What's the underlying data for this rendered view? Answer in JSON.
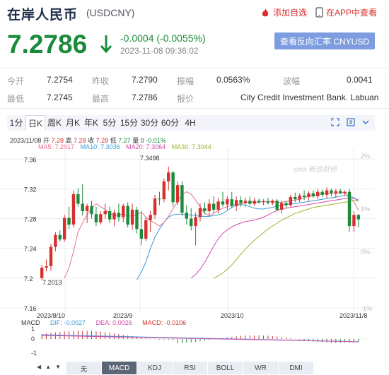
{
  "header": {
    "title": "在岸人民币",
    "code": "(USDCNY)",
    "watch_label": "添加自选",
    "app_label": "在APP中查看"
  },
  "quote": {
    "price": "7.2786",
    "change": "-0.0004 (-0.0055%)",
    "time": "2023-11-08 09:36:02",
    "reverse_label": "查看反向汇率 CNYUSD"
  },
  "stats": {
    "open_label": "今开",
    "open": "7.2754",
    "prev_label": "昨收",
    "prev": "7.2790",
    "amp_label": "振幅",
    "amp": "0.0563%",
    "wave_label": "波幅",
    "wave": "0.0041",
    "low_label": "最低",
    "low": "7.2745",
    "high_label": "最高",
    "high": "7.2786",
    "quote_label": "报价",
    "quote_src": "City Credit Investment Bank. Labuan"
  },
  "tabs": [
    "1分",
    "日K",
    "周K",
    "月K",
    "年K",
    "5分",
    "15分",
    "30分",
    "60分",
    "4H"
  ],
  "active_tab": 1,
  "ohlc_line": {
    "date": "2023/11/08",
    "open_label": "开",
    "open": "7.28",
    "high_label": "高",
    "high": "7.28",
    "close_label": "收",
    "close": "7.28",
    "low_label": "低",
    "low": "7.27",
    "vol_label": "量",
    "vol": "0",
    "pct": "-0.01%"
  },
  "ma": {
    "ma5": "MA5: 7.2917",
    "ma10": "MA10: 7.3036",
    "ma20": "MA20: 7.3064",
    "ma30": "MA30: 7.3044"
  },
  "colors": {
    "up": "#d8302f",
    "down": "#1a8a3b",
    "ma5": "#e8728c",
    "ma10": "#3b9ad9",
    "ma20": "#d24aa8",
    "ma30": "#9bb52f"
  },
  "chart_data": {
    "type": "candlestick",
    "y_ticks": [
      "7.36",
      "7.32",
      "7.28",
      "7.24",
      "7.2",
      "7.16"
    ],
    "y_ticks_pct": [
      "2%",
      "1%",
      "0%",
      "-1%"
    ],
    "x_ticks": [
      "2023/8/10",
      "2023/9",
      "2023/10",
      "2023/11/8"
    ],
    "max_label": "7.3498",
    "min_label": "7.2013",
    "ylim": [
      7.16,
      7.365
    ],
    "candles": [
      [
        7.2,
        7.218,
        7.197,
        7.214
      ],
      [
        7.214,
        7.225,
        7.209,
        7.216
      ],
      [
        7.216,
        7.246,
        7.21,
        7.242
      ],
      [
        7.242,
        7.262,
        7.236,
        7.258
      ],
      [
        7.258,
        7.264,
        7.249,
        7.252
      ],
      [
        7.252,
        7.285,
        7.249,
        7.281
      ],
      [
        7.281,
        7.296,
        7.266,
        7.272
      ],
      [
        7.272,
        7.318,
        7.268,
        7.313
      ],
      [
        7.313,
        7.321,
        7.296,
        7.3
      ],
      [
        7.3,
        7.326,
        7.284,
        7.29
      ],
      [
        7.29,
        7.3,
        7.274,
        7.297
      ],
      [
        7.297,
        7.304,
        7.28,
        7.286
      ],
      [
        7.286,
        7.296,
        7.27,
        7.275
      ],
      [
        7.275,
        7.29,
        7.272,
        7.286
      ],
      [
        7.286,
        7.3,
        7.28,
        7.29
      ],
      [
        7.29,
        7.296,
        7.274,
        7.279
      ],
      [
        7.279,
        7.292,
        7.27,
        7.288
      ],
      [
        7.288,
        7.3,
        7.276,
        7.282
      ],
      [
        7.282,
        7.3,
        7.275,
        7.297
      ],
      [
        7.297,
        7.302,
        7.268,
        7.272
      ],
      [
        7.272,
        7.3,
        7.265,
        7.292
      ],
      [
        7.292,
        7.296,
        7.26,
        7.266
      ],
      [
        7.266,
        7.29,
        7.244,
        7.253
      ],
      [
        7.253,
        7.282,
        7.25,
        7.278
      ],
      [
        7.278,
        7.29,
        7.262,
        7.285
      ],
      [
        7.285,
        7.312,
        7.28,
        7.307
      ],
      [
        7.307,
        7.316,
        7.298,
        7.306
      ],
      [
        7.306,
        7.334,
        7.302,
        7.33
      ],
      [
        7.33,
        7.35,
        7.318,
        7.342
      ],
      [
        7.342,
        7.344,
        7.296,
        7.302
      ],
      [
        7.302,
        7.33,
        7.298,
        7.325
      ],
      [
        7.325,
        7.33,
        7.284,
        7.288
      ],
      [
        7.288,
        7.298,
        7.272,
        7.28
      ],
      [
        7.28,
        7.294,
        7.264,
        7.27
      ],
      [
        7.27,
        7.288,
        7.244,
        7.282
      ],
      [
        7.282,
        7.3,
        7.276,
        7.294
      ],
      [
        7.294,
        7.302,
        7.286,
        7.29
      ],
      [
        7.29,
        7.306,
        7.284,
        7.3
      ],
      [
        7.3,
        7.31,
        7.288,
        7.292
      ],
      [
        7.292,
        7.308,
        7.287,
        7.303
      ],
      [
        7.303,
        7.316,
        7.296,
        7.299
      ],
      [
        7.299,
        7.31,
        7.292,
        7.306
      ],
      [
        7.306,
        7.316,
        7.294,
        7.297
      ],
      [
        7.297,
        7.31,
        7.29,
        7.305
      ],
      [
        7.305,
        7.31,
        7.296,
        7.301
      ],
      [
        7.301,
        7.308,
        7.296,
        7.304
      ],
      [
        7.304,
        7.31,
        7.298,
        7.3
      ],
      [
        7.3,
        7.308,
        7.297,
        7.304
      ],
      [
        7.304,
        7.307,
        7.3,
        7.302
      ],
      [
        7.302,
        7.306,
        7.298,
        7.303
      ],
      [
        7.303,
        7.308,
        7.299,
        7.301
      ],
      [
        7.301,
        7.306,
        7.298,
        7.304
      ],
      [
        7.304,
        7.306,
        7.29,
        7.292
      ],
      [
        7.292,
        7.304,
        7.287,
        7.301
      ],
      [
        7.301,
        7.304,
        7.294,
        7.298
      ],
      [
        7.298,
        7.312,
        7.296,
        7.309
      ],
      [
        7.309,
        7.315,
        7.302,
        7.306
      ],
      [
        7.306,
        7.314,
        7.302,
        7.311
      ],
      [
        7.311,
        7.318,
        7.305,
        7.309
      ],
      [
        7.309,
        7.317,
        7.304,
        7.314
      ],
      [
        7.314,
        7.318,
        7.308,
        7.31
      ],
      [
        7.31,
        7.32,
        7.306,
        7.316
      ],
      [
        7.316,
        7.319,
        7.309,
        7.312
      ],
      [
        7.312,
        7.322,
        7.308,
        7.318
      ],
      [
        7.318,
        7.32,
        7.31,
        7.314
      ],
      [
        7.314,
        7.32,
        7.308,
        7.317
      ],
      [
        7.317,
        7.32,
        7.313,
        7.314
      ],
      [
        7.314,
        7.318,
        7.311,
        7.316
      ],
      [
        7.316,
        7.32,
        7.262,
        7.27
      ],
      [
        7.27,
        7.29,
        7.262,
        7.285
      ],
      [
        7.285,
        7.286,
        7.268,
        7.279
      ]
    ],
    "ma5": [
      7.2,
      7.214,
      7.236,
      7.262,
      7.274,
      7.285,
      7.294,
      7.3,
      7.296,
      7.292,
      7.287,
      7.284,
      7.285,
      7.286,
      7.284,
      7.283,
      7.285,
      7.289,
      7.282,
      7.277,
      7.274,
      7.27,
      7.275,
      7.283,
      7.293,
      7.303,
      7.312,
      7.316,
      7.313,
      7.305,
      7.296,
      7.287,
      7.284,
      7.287,
      7.291,
      7.294,
      7.296,
      7.298,
      7.299,
      7.3,
      7.301,
      7.302,
      7.302,
      7.302,
      7.303,
      7.303,
      7.303,
      7.302,
      7.302,
      7.303,
      7.304,
      7.305,
      7.306,
      7.308,
      7.31,
      7.311,
      7.312,
      7.313,
      7.314,
      7.314,
      7.314,
      7.315,
      7.315,
      7.309,
      7.303,
      7.291
    ],
    "ma10": [
      7.198,
      7.208,
      7.222,
      7.24,
      7.255,
      7.266,
      7.275,
      7.282,
      7.285,
      7.286,
      7.286,
      7.285,
      7.285,
      7.284,
      7.283,
      7.283,
      7.283,
      7.284,
      7.285,
      7.287,
      7.291,
      7.295,
      7.298,
      7.299,
      7.298,
      7.296,
      7.294,
      7.293,
      7.293,
      7.294,
      7.295,
      7.297,
      7.298,
      7.299,
      7.3,
      7.3,
      7.301,
      7.302,
      7.303,
      7.304,
      7.305,
      7.306,
      7.307,
      7.308,
      7.309,
      7.31,
      7.311,
      7.311,
      7.308,
      7.303
    ],
    "ma20": [
      7.2,
      7.205,
      7.212,
      7.221,
      7.232,
      7.243,
      7.253,
      7.26,
      7.265,
      7.269,
      7.272,
      7.274,
      7.276,
      7.277,
      7.278,
      7.28,
      7.282,
      7.285,
      7.288,
      7.291,
      7.293,
      7.294,
      7.295,
      7.296,
      7.297,
      7.298,
      7.299,
      7.3,
      7.301,
      7.302,
      7.303,
      7.304,
      7.305,
      7.306,
      7.307,
      7.307,
      7.307,
      7.306
    ],
    "ma30": [
      7.2,
      7.203,
      7.207,
      7.212,
      7.218,
      7.225,
      7.232,
      7.239,
      7.245,
      7.251,
      7.256,
      7.261,
      7.266,
      7.27,
      7.274,
      7.278,
      7.281,
      7.284,
      7.287,
      7.289,
      7.291,
      7.293,
      7.295,
      7.296,
      7.297,
      7.298,
      7.299,
      7.3,
      7.301,
      7.302,
      7.303,
      7.304,
      7.304
    ]
  },
  "macd": {
    "dif_label": "DIF: -0.0027",
    "dea_label": "DEA: 0.0026",
    "macd_label": "MACD: -0.0106",
    "title": "MACD",
    "y_ticks": [
      "1",
      "0",
      "-1"
    ]
  },
  "indicator_buttons": [
    "无",
    "MACD",
    "KDJ",
    "RSI",
    "BOLL",
    "WR",
    "DMI"
  ],
  "active_indicator": 1,
  "watermark": "sina 新浪财经"
}
